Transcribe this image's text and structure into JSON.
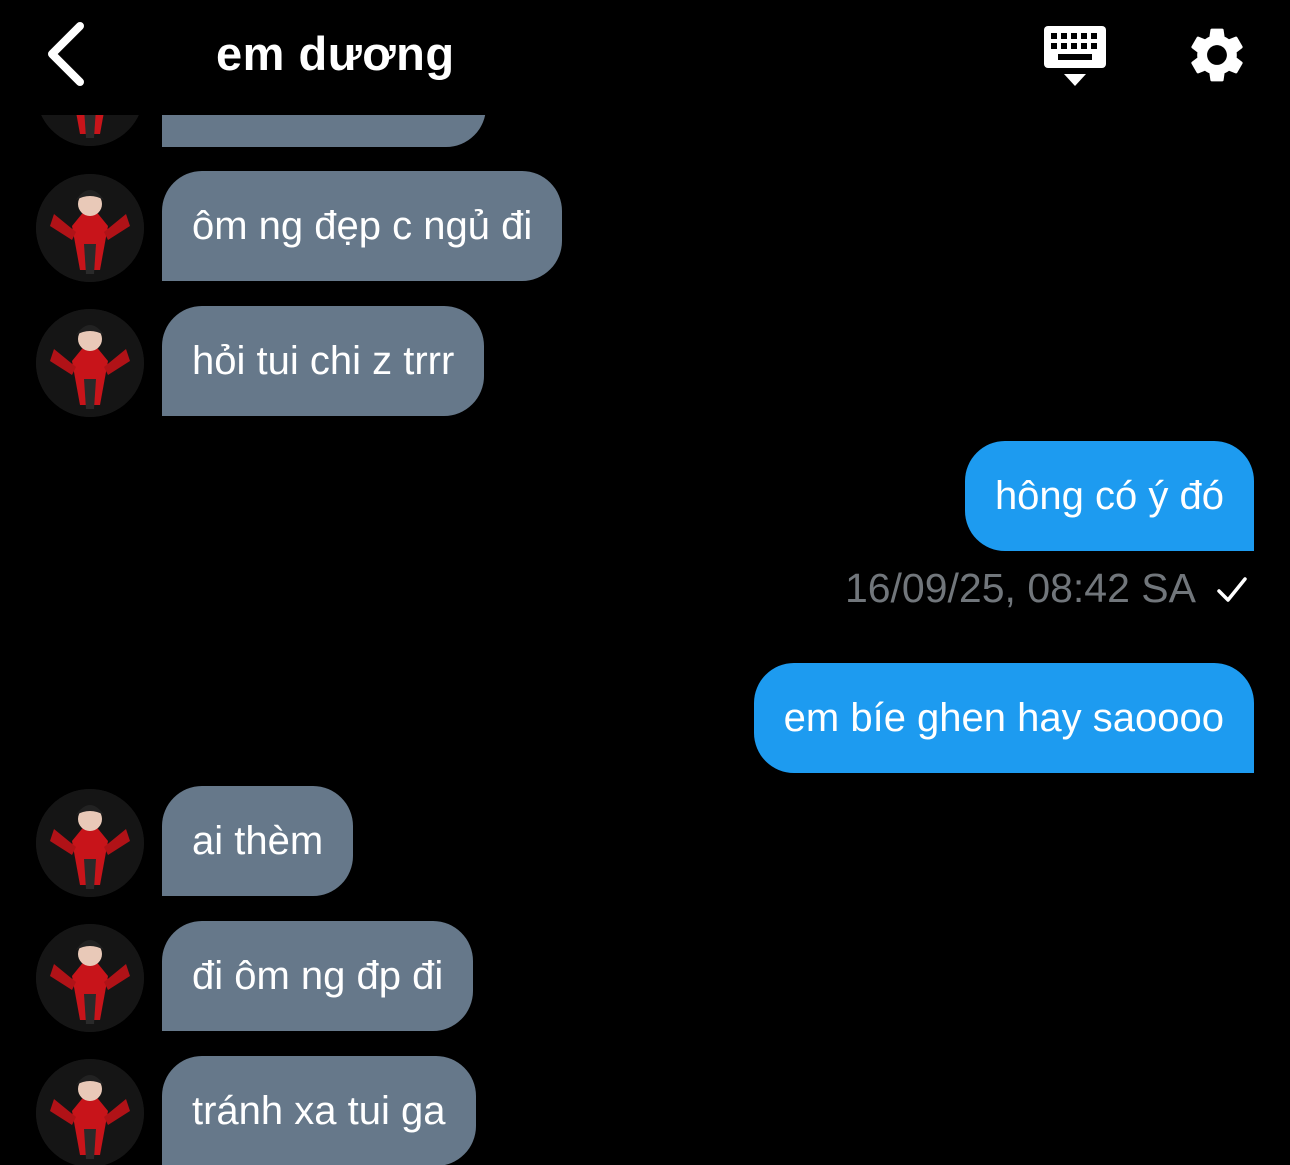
{
  "header": {
    "back_icon": "chevron-left-icon",
    "title": "em dương",
    "keyboard_icon": "keyboard-icon",
    "settings_icon": "gear-icon"
  },
  "messages": [
    {
      "direction": "incoming",
      "text": "ôm ng đẹp c ngủ đi"
    },
    {
      "direction": "incoming",
      "text": "hỏi tui chi z trrr"
    },
    {
      "direction": "outgoing",
      "text": "hông có ý đó"
    },
    {
      "direction": "outgoing",
      "text": "em bíe ghen hay saoooo"
    },
    {
      "direction": "incoming",
      "text": "ai thèm"
    },
    {
      "direction": "incoming",
      "text": "đi ôm ng đp đi"
    },
    {
      "direction": "incoming",
      "text": "tránh xa tui ga"
    }
  ],
  "read_receipt": {
    "timestamp": "16/09/25, 08:42 SA",
    "icon": "checkmark-icon"
  },
  "colors": {
    "background": "#000000",
    "incoming_bubble": "#66788a",
    "outgoing_bubble": "#1d9bf0",
    "timestamp": "#71767b"
  }
}
